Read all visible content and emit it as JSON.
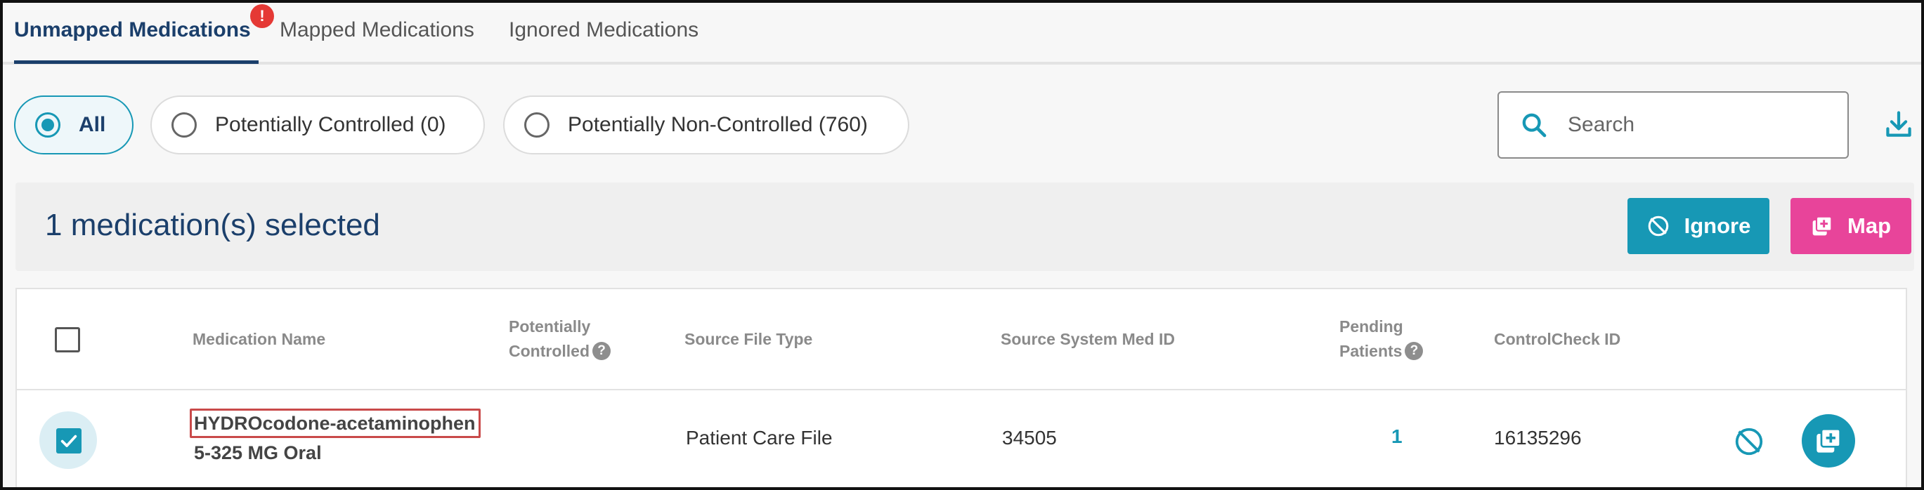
{
  "tabs": [
    {
      "label": "Unmapped Medications",
      "active": true,
      "badge": "!"
    },
    {
      "label": "Mapped Medications",
      "active": false
    },
    {
      "label": "Ignored Medications",
      "active": false
    }
  ],
  "filters": [
    {
      "label": "All",
      "selected": true
    },
    {
      "label": "Potentially Controlled (0)",
      "selected": false
    },
    {
      "label": "Potentially Non-Controlled (760)",
      "selected": false
    }
  ],
  "search": {
    "placeholder": "Search",
    "value": "",
    "icon": "search-icon"
  },
  "download": {
    "icon": "download-icon"
  },
  "selection_bar": {
    "text": "1 medication(s) selected",
    "ignore_label": "Ignore",
    "map_label": "Map"
  },
  "table": {
    "columns": {
      "medication_name": "Medication Name",
      "potentially_line1": "Potentially",
      "potentially_line2": "Controlled",
      "source_file_type": "Source File Type",
      "source_system_med_id": "Source System Med ID",
      "pending_line1": "Pending",
      "pending_line2": "Patients",
      "controlcheck_id": "ControlCheck ID"
    },
    "rows": [
      {
        "selected": true,
        "name_line1": "HYDROcodone-acetaminophen",
        "name_line2": "5-325 MG Oral",
        "potentially_controlled": "",
        "source_file_type": "Patient Care File",
        "source_system_med_id": "34505",
        "pending_patients": "1",
        "controlcheck_id": "16135296"
      }
    ]
  },
  "colors": {
    "primary": "#1798b5",
    "navy": "#1b3f6b",
    "map_pink": "#e8449a",
    "alert_red": "#e53935",
    "highlight_border": "#c94a4a"
  }
}
